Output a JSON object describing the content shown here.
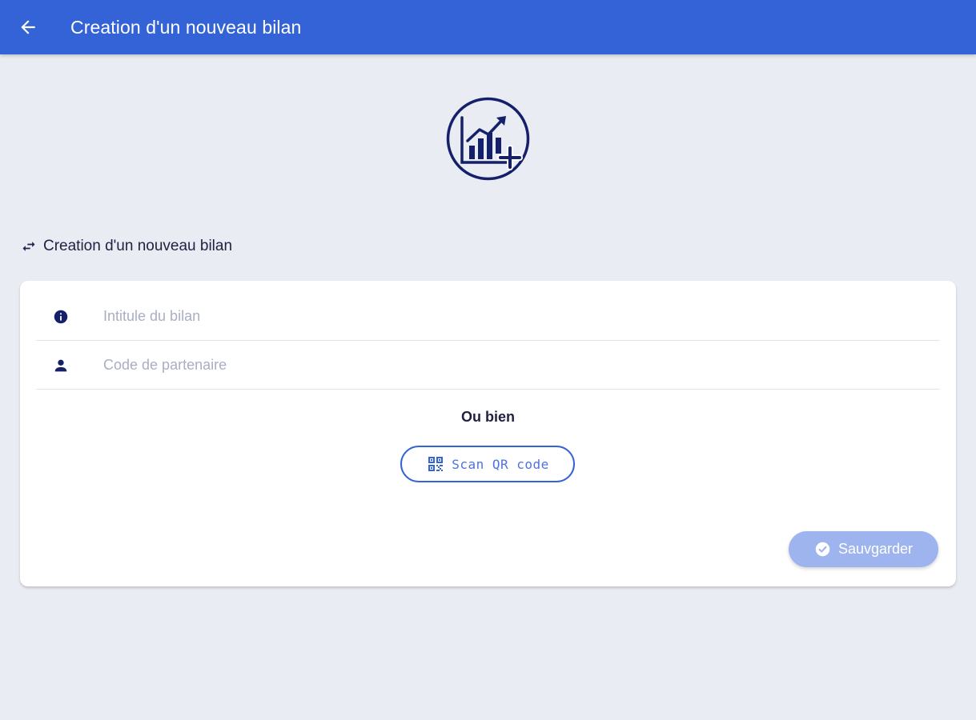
{
  "colors": {
    "primary": "#3363d6",
    "navy": "#15206a",
    "background": "#e9ecf2",
    "save_disabled": "#9db4ef"
  },
  "header": {
    "title": "Creation d'un nouveau bilan",
    "back_icon": "arrow-left-icon"
  },
  "hero": {
    "icon": "chart-plus-icon"
  },
  "section": {
    "icon": "swap-arrows-icon",
    "title": "Creation d'un nouveau bilan"
  },
  "form": {
    "title_field": {
      "icon": "info-icon",
      "placeholder": "Intitule du bilan",
      "value": ""
    },
    "partner_field": {
      "icon": "person-icon",
      "placeholder": "Code de partenaire",
      "value": ""
    },
    "separator_text": "Ou bien",
    "scan_button": {
      "icon": "qr-code-icon",
      "label": "Scan QR code"
    },
    "save_button": {
      "icon": "check-circle-icon",
      "label": "Sauvgarder"
    }
  }
}
